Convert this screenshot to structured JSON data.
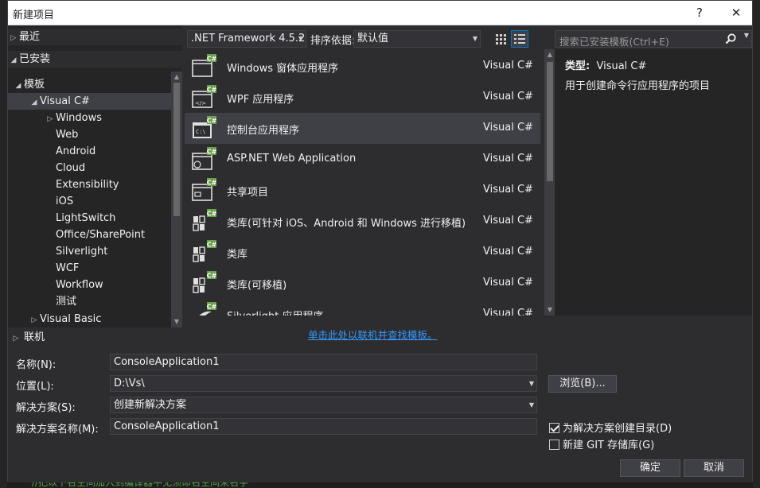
{
  "background": {
    "bottom_text": "//把以下名空间加入到编译器中无须命名空间来名字"
  },
  "dialog": {
    "title": "新建项目",
    "help_label": "?",
    "close_label": "✕"
  },
  "tree": {
    "recent": "最近",
    "installed": "已安装",
    "templates": "模板",
    "visual_csharp": "Visual C#",
    "children": [
      "Windows",
      "Web",
      "Android",
      "Cloud",
      "Extensibility",
      "iOS",
      "LightSwitch",
      "Office/SharePoint",
      "Silverlight",
      "WCF",
      "Workflow",
      "测试"
    ],
    "visual_basic": "Visual Basic",
    "online": "联机"
  },
  "toolbar": {
    "framework": ".NET Framework 4.5.2",
    "sort_label": "排序依据:",
    "sort_value": "默认值"
  },
  "templates": [
    {
      "name": "Windows 窗体应用程序",
      "lang": "Visual C#",
      "icon": "windows-forms-icon"
    },
    {
      "name": "WPF 应用程序",
      "lang": "Visual C#",
      "icon": "wpf-icon"
    },
    {
      "name": "控制台应用程序",
      "lang": "Visual C#",
      "icon": "console-icon"
    },
    {
      "name": "ASP.NET Web Application",
      "lang": "Visual C#",
      "icon": "web-app-icon"
    },
    {
      "name": "共享项目",
      "lang": "Visual C#",
      "icon": "shared-project-icon"
    },
    {
      "name": "类库(可针对 iOS、Android 和 Windows 进行移植)",
      "lang": "Visual C#",
      "icon": "portable-library-icon"
    },
    {
      "name": "类库",
      "lang": "Visual C#",
      "icon": "class-library-icon"
    },
    {
      "name": "类库(可移植)",
      "lang": "Visual C#",
      "icon": "portable-class-library-icon"
    },
    {
      "name": "Silverlight 应用程序",
      "lang": "Visual C#",
      "icon": "silverlight-icon"
    }
  ],
  "online_link": "单击此处以联机并查找模板。",
  "search": {
    "placeholder": "搜索已安装模板(Ctrl+E)"
  },
  "detail": {
    "type_label": "类型:",
    "type_value": "Visual C#",
    "description": "用于创建命令行应用程序的项目"
  },
  "form": {
    "name_label": "名称(N):",
    "name_value": "ConsoleApplication1",
    "location_label": "位置(L):",
    "location_value": "D:\\Vs\\",
    "solution_label": "解决方案(S):",
    "solution_value": "创建新解决方案",
    "solution_name_label": "解决方案名称(M):",
    "solution_name_value": "ConsoleApplication1",
    "browse": "浏览(B)...",
    "create_dir": "为解决方案创建目录(D)",
    "create_dir_checked": true,
    "git": "新建 GIT 存储库(G)",
    "git_checked": false,
    "ok": "确定",
    "cancel": "取消"
  },
  "colors": {
    "accent": "#007acc",
    "csharp_badge": "#68a14a",
    "link": "#3399ff"
  }
}
